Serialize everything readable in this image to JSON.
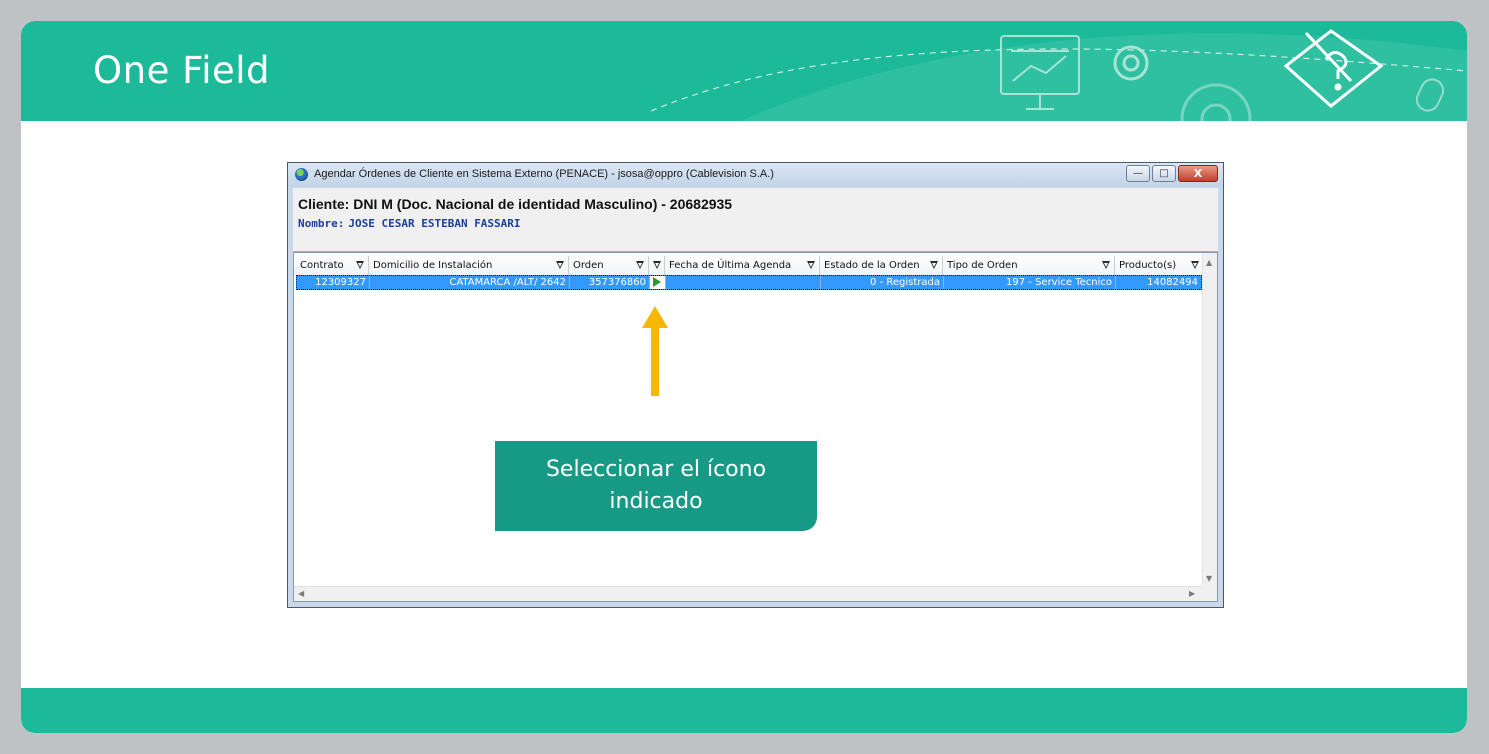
{
  "slide": {
    "title": "One Field",
    "accent_color": "#1dba9a",
    "header_icons": [
      "presentation-board-icon",
      "gear-icon",
      "pencil-question-icon",
      "mouse-icon"
    ]
  },
  "window": {
    "title": "Agendar Órdenes de Cliente en Sistema Externo (PENACE) - jsosa@oppro (Cablevision S.A.)",
    "controls": {
      "minimize": "—",
      "maximize": "□",
      "close": "X"
    }
  },
  "client": {
    "header": "Cliente: DNI M (Doc. Nacional de identidad Masculino) - 20682935",
    "name_label": "Nombre:",
    "name_value": "JOSE CESAR ESTEBAN  FASSARI"
  },
  "grid": {
    "columns": [
      {
        "label": "Contrato"
      },
      {
        "label": "Domicilio de Instalación"
      },
      {
        "label": "Orden"
      },
      {
        "label": ""
      },
      {
        "label": "Fecha de Última Agenda"
      },
      {
        "label": "Estado de la Orden"
      },
      {
        "label": "Tipo de Orden"
      },
      {
        "label": "Producto(s)"
      }
    ],
    "rows": [
      {
        "contrato": "12309327",
        "domicilio": "CATAMARCA /ALT/ 2642",
        "orden": "357376860",
        "action_icon": "play-icon",
        "fecha": "",
        "estado": "0 - Registrada",
        "tipo": "197 - Service Tecnico",
        "producto": "14082494"
      }
    ],
    "selected_row_color": "#3399ff"
  },
  "annotation": {
    "text": "Seleccionar el ícono indicado",
    "arrow_color": "#f5b800",
    "box_color": "#179a85"
  }
}
